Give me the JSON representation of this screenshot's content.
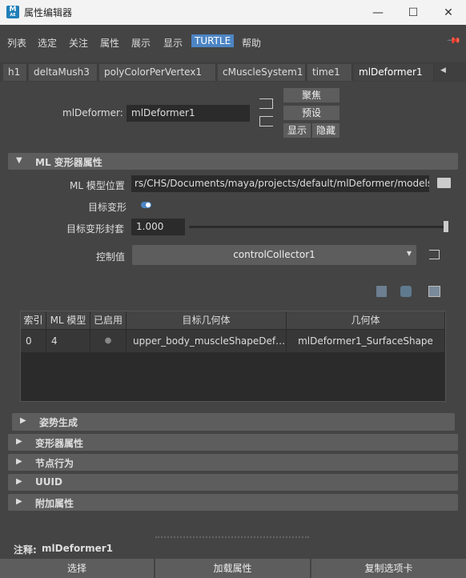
{
  "window": {
    "title": "属性编辑器",
    "app_icon_letter": "M",
    "app_icon_sub": "AE",
    "minimize_glyph": "—",
    "maximize_glyph": "☐",
    "close_glyph": "✕"
  },
  "menubar": {
    "items": [
      "列表",
      "选定",
      "关注",
      "属性",
      "展示",
      "显示",
      "TURTLE",
      "帮助"
    ],
    "active_item": "TURTLE",
    "pin_glyph": "📌"
  },
  "tabs": {
    "items": [
      "h1",
      "deltaMush3",
      "polyColorPerVertex1",
      "cMuscleSystem1",
      "time1",
      "mlDeformer1"
    ],
    "active": "mlDeformer1",
    "scroll_glyph": "◀"
  },
  "node": {
    "type_label": "mlDeformer:",
    "name_value": "mlDeformer1",
    "focus_label": "聚焦",
    "presets_label": "预设",
    "show_label": "显示",
    "hide_label": "隐藏"
  },
  "ml_section": {
    "title": "ML 变形器属性",
    "model_path_label": "ML 模型位置",
    "model_path_value": "rs/CHS/Documents/maya/projects/default/mlDeformer/models",
    "target_deform_label": "目标变形",
    "target_envelope_label": "目标变形封套",
    "target_envelope_value": "1.000",
    "target_envelope_fraction": 1.0,
    "control_label": "控制值",
    "control_value": "controlCollector1"
  },
  "table": {
    "headers": [
      "索引",
      "ML 模型",
      "已启用",
      "目标几何体",
      "几何体"
    ],
    "rows": [
      {
        "index": "0",
        "model": "4",
        "enabled": "●",
        "target": "upper_body_muscleShapeDef…",
        "geometry": "mlDeformer1_SurfaceShape"
      }
    ]
  },
  "sections": [
    {
      "title": "姿势生成"
    },
    {
      "title": "变形器属性"
    },
    {
      "title": "节点行为"
    },
    {
      "title": "UUID"
    },
    {
      "title": "附加属性"
    }
  ],
  "notes": {
    "label": "注释:",
    "value": "mlDeformer1"
  },
  "bottom_buttons": [
    "选择",
    "加载属性",
    "复制选项卡"
  ],
  "colors": {
    "accent": "#4c85c4",
    "panel": "#444444",
    "field": "#2b2b2b",
    "button": "#5d5d5d"
  }
}
